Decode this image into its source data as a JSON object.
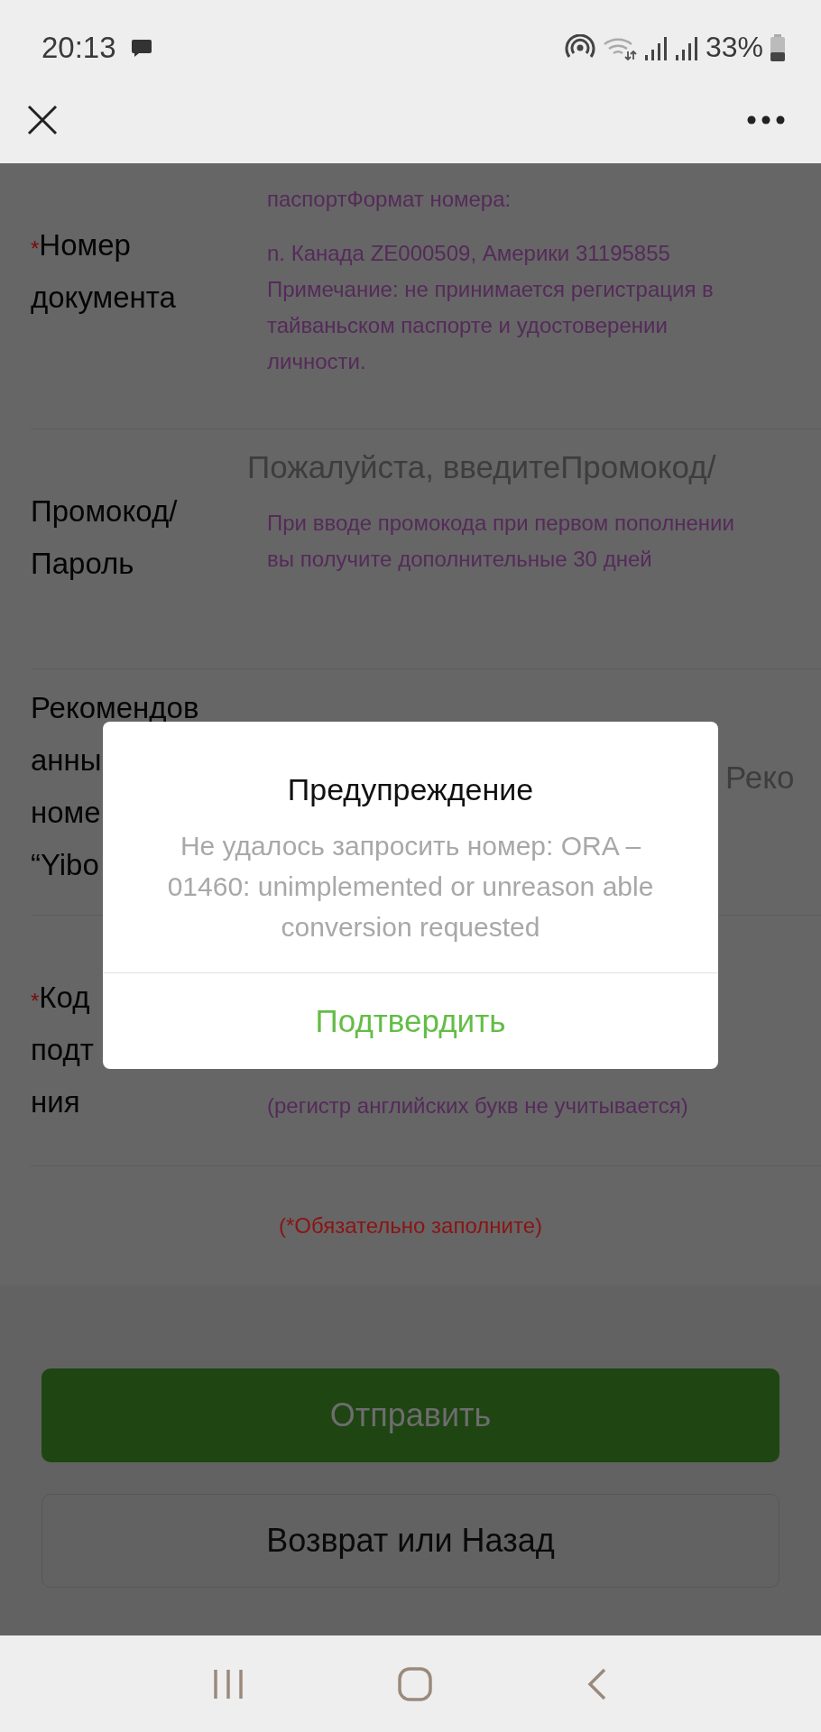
{
  "status_bar": {
    "time": "20:13",
    "battery": "33%"
  },
  "form": {
    "rows": [
      {
        "label_lines": [
          "Номер",
          "документа"
        ],
        "required_mark": "*",
        "placeholder": "",
        "hints": [
          "паспортФормат номера:",
          "n. Канада ZE000509, Америки 31195855 Примечание: не принимается регистрация в тайваньском паспорте и удостоверении личности."
        ]
      },
      {
        "label_lines": [
          "Промокод/",
          "Пароль"
        ],
        "placeholder": "Пожалуйста, введитеПромокод/",
        "hints": [
          "При вводе промокода при первом пополнении вы получите дополнительные 30 дней"
        ]
      },
      {
        "label_lines": [
          "Рекомендов",
          "анны",
          "номе",
          "“Yibo"
        ],
        "placeholder": "Реко",
        "hints": []
      },
      {
        "label_lines": [
          "Код",
          "подт",
          "ния"
        ],
        "required_mark": "*",
        "placeholder": "",
        "hints": [
          "(регистр английских букв не учитывается)"
        ]
      }
    ],
    "required_note": "(*Обязательно заполните)"
  },
  "buttons": {
    "submit": "Отправить",
    "back": "Возврат или Назад"
  },
  "dialog": {
    "title": "Предупреждение",
    "message": "Не удалось запросить номер: ORA –01460: unimplemented or unreason able conversion requested",
    "confirm": "Подтвердить"
  }
}
